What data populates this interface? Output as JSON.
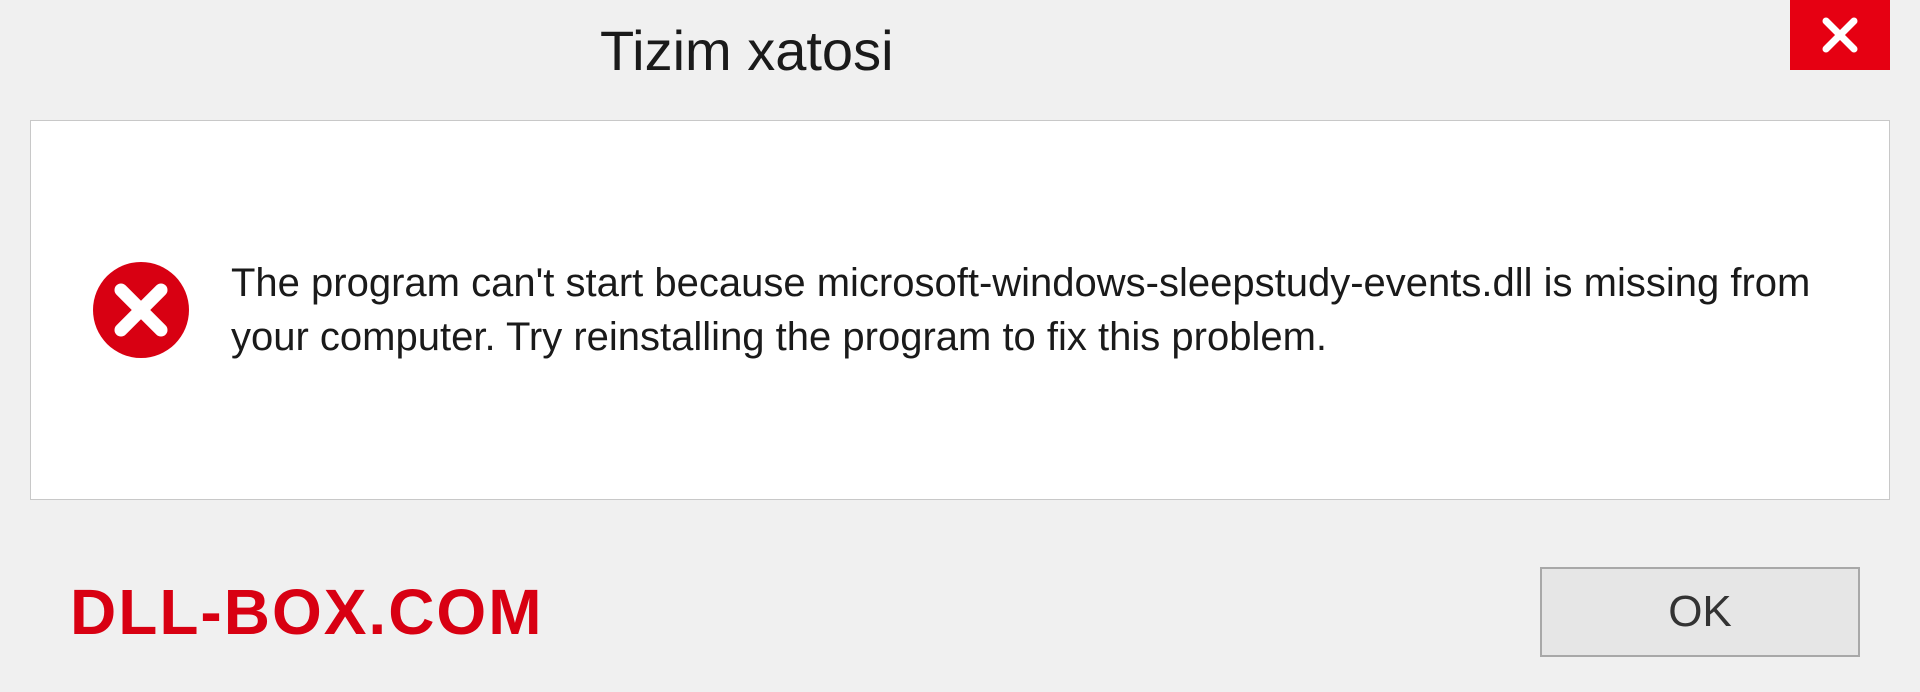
{
  "dialog": {
    "title": "Tizim xatosi",
    "message": "The program can't start because microsoft-windows-sleepstudy-events.dll is missing from your computer. Try reinstalling the program to fix this problem.",
    "ok_label": "OK"
  },
  "watermark": "DLL-BOX.COM"
}
